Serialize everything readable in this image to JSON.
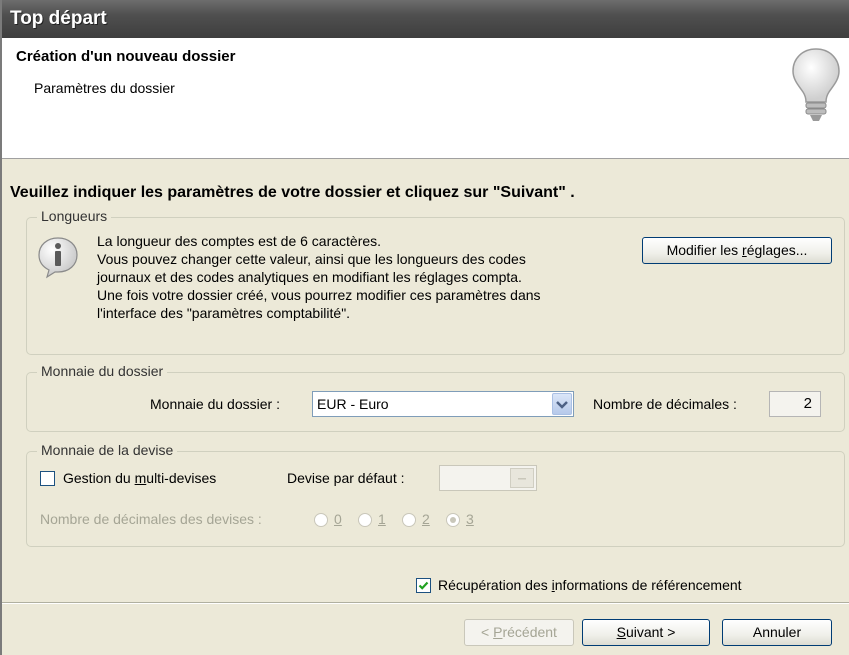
{
  "window": {
    "title": "Top départ"
  },
  "header": {
    "title": "Création d'un nouveau dossier",
    "subtitle": "Paramètres du dossier",
    "icon": "lightbulb-icon"
  },
  "instruction": "Veuillez indiquer les paramètres de votre dossier et cliquez sur \"Suivant\" .",
  "longueurs": {
    "legend": "Longueurs",
    "icon": "info-icon",
    "lines": [
      "La longueur des comptes est de 6 caractères.",
      "Vous pouvez changer cette valeur, ainsi que les longueurs des codes",
      "journaux  et des codes analytiques en modifiant les réglages compta.",
      "Une fois votre dossier créé, vous pourrez modifier ces paramètres dans",
      "l'interface des \"paramètres comptabilité\"."
    ],
    "button_prefix": "Modifier les ",
    "button_accel": "r",
    "button_suffix": "églages..."
  },
  "monnaie_dossier": {
    "legend": "Monnaie du dossier",
    "label": "Monnaie du dossier :",
    "selected": "EUR - Euro",
    "decimales_label": "Nombre de décimales :",
    "decimales_value": "2"
  },
  "monnaie_devise": {
    "legend": "Monnaie de la devise",
    "multi_checkbox_prefix": "Gestion du ",
    "multi_checkbox_accel": "m",
    "multi_checkbox_suffix": "ulti-devises",
    "multi_checked": false,
    "devise_label": "Devise par défaut :",
    "devise_value": "",
    "decimales_devises_label": "Nombre de décimales des devises :",
    "radio_options": [
      "0",
      "1",
      "2",
      "3"
    ],
    "radio_selected": "3"
  },
  "recuperation": {
    "prefix": "Récupération des ",
    "accel": "i",
    "suffix": "nformations de référencement",
    "checked": true
  },
  "footer": {
    "prev_prefix": "< ",
    "prev_accel": "P",
    "prev_suffix": "récédent",
    "next_accel": "S",
    "next_suffix": "uivant >",
    "cancel_label": "Annuler"
  }
}
